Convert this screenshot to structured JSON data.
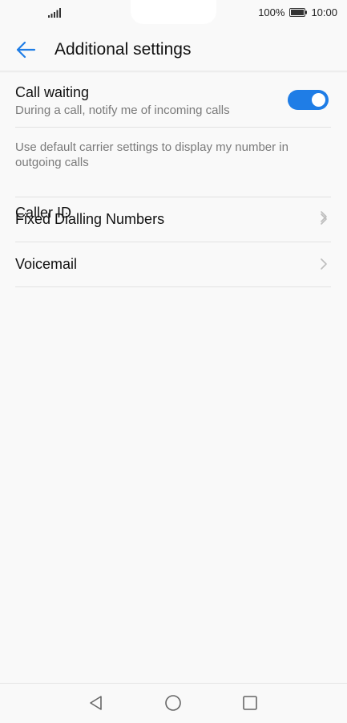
{
  "status_bar": {
    "battery_percent": "100%",
    "time": "10:00",
    "icons": [
      "signal-icon",
      "battery-icon"
    ]
  },
  "header": {
    "title": "Additional settings",
    "back_icon": "back-arrow-icon"
  },
  "settings": {
    "items": [
      {
        "title": "Call waiting",
        "subtitle": "During a call, notify me of incoming calls",
        "control": "toggle",
        "toggle_on": true
      },
      {
        "title": "Caller ID",
        "subtitle": "Use default carrier settings to display my number in outgoing calls",
        "control": "chevron"
      },
      {
        "title": "Fixed Dialling Numbers",
        "control": "chevron"
      },
      {
        "title": "Voicemail",
        "control": "chevron"
      }
    ]
  },
  "navigation": {
    "icons": [
      "back-triangle-icon",
      "home-circle-icon",
      "recents-square-icon"
    ]
  },
  "colors": {
    "accent": "#1f7de6",
    "background": "#f9f9f9",
    "divider": "#e2e2e2",
    "subtitle": "#7a7a7a"
  }
}
